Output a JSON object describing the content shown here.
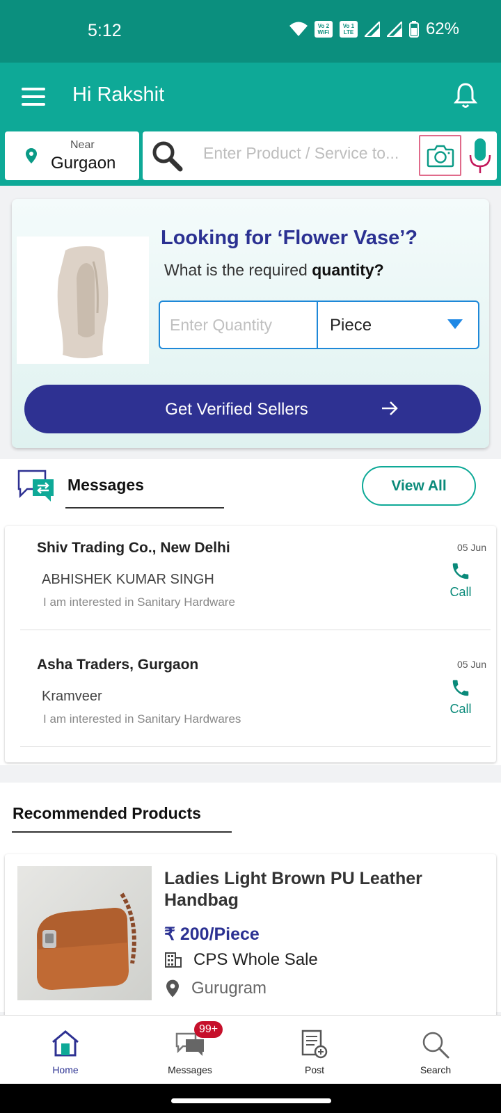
{
  "status": {
    "time": "5:12",
    "battery": "62%",
    "sim1_label": "Vo WiFi",
    "sim2_label": "Vo LTE"
  },
  "header": {
    "greeting": "Hi Rakshit"
  },
  "location": {
    "near_label": "Near",
    "city": "Gurgaon"
  },
  "search": {
    "placeholder": "Enter Product / Service to..."
  },
  "rfq": {
    "title": "Looking for ‘Flower Vase’?",
    "subtitle_prefix": "What is the required ",
    "subtitle_bold": "quantity?",
    "quantity_placeholder": "Enter Quantity",
    "unit": "Piece",
    "cta_label": "Get Verified Sellers"
  },
  "messages": {
    "title": "Messages",
    "view_all": "View All",
    "items": [
      {
        "company": "Shiv Trading Co., New Delhi",
        "person": "ABHISHEK KUMAR SINGH",
        "text": "I am interested in Sanitary Hardware",
        "date": "05 Jun",
        "call_label": "Call"
      },
      {
        "company": "Asha Traders, Gurgaon",
        "person": "Kramveer",
        "text": "I am interested in Sanitary Hardwares",
        "date": "05 Jun",
        "call_label": "Call"
      }
    ]
  },
  "recommended": {
    "title": "Recommended Products",
    "product": {
      "name": "Ladies Light Brown PU Leather Handbag",
      "price": "₹ 200/Piece",
      "seller": "CPS Whole Sale",
      "location": "Gurugram"
    }
  },
  "nav": {
    "items": [
      {
        "label": "Home",
        "icon": "home-icon",
        "active": true
      },
      {
        "label": "Messages",
        "icon": "messages-icon",
        "badge": "99+"
      },
      {
        "label": "Post",
        "icon": "post-icon"
      },
      {
        "label": "Search",
        "icon": "search-icon"
      }
    ]
  },
  "colors": {
    "primary_teal": "#0ea997",
    "status_teal": "#0b8f7e",
    "brand_blue": "#2e3192",
    "badge_red": "#c6102b",
    "mic_red": "#c2185b"
  }
}
